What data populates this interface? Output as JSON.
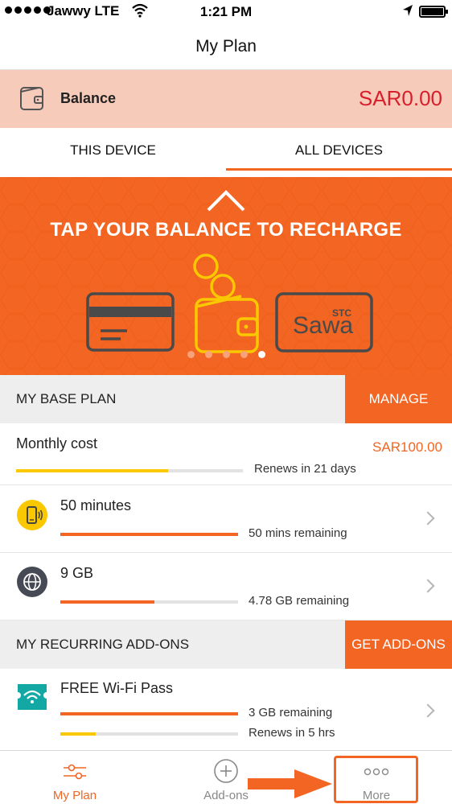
{
  "status_bar": {
    "carrier": "Jawwy LTE",
    "time": "1:21 PM"
  },
  "nav": {
    "title": "My Plan"
  },
  "balance": {
    "label": "Balance",
    "amount": "SAR0.00"
  },
  "tabs": [
    {
      "label": "THIS DEVICE",
      "active": false
    },
    {
      "label": "ALL DEVICES",
      "active": true
    }
  ],
  "banner": {
    "title": "TAP YOUR BALANCE TO RECHARGE",
    "sawa_brand": "STC",
    "sawa_text": "Sawa",
    "page_count": 5,
    "active_page": 5
  },
  "base_plan": {
    "title": "MY BASE PLAN",
    "button": "MANAGE",
    "monthly": {
      "label": "Monthly cost",
      "amount": "SAR100.00",
      "renew": "Renews in 21 days",
      "progress": 0.67
    },
    "items": [
      {
        "icon": "phone-icon",
        "name": "50 minutes",
        "remaining": "50 mins remaining",
        "progress": 1.0
      },
      {
        "icon": "globe-icon",
        "name": "9 GB",
        "remaining": "4.78 GB remaining",
        "progress": 0.53
      }
    ]
  },
  "addons": {
    "title": "MY RECURRING ADD-ONS",
    "button": "GET ADD-ONS",
    "items": [
      {
        "icon": "wifi-ticket-icon",
        "name": "FREE Wi-Fi Pass",
        "remaining": "3 GB remaining",
        "progress": 1.0,
        "renew": "Renews in 5 hrs",
        "renew_progress": 0.2
      }
    ]
  },
  "tabbar": {
    "items": [
      {
        "icon": "sliders-icon",
        "label": "My Plan",
        "active": true
      },
      {
        "icon": "plus-circle-icon",
        "label": "Add-ons",
        "active": false
      },
      {
        "icon": "more-dots-icon",
        "label": "More",
        "active": false
      }
    ]
  },
  "colors": {
    "accent": "#f26522",
    "balance_bg": "#f7cbb9",
    "balance_amount": "#d8202c",
    "yellow": "#f9c800",
    "section_bg": "#eeeeee"
  }
}
